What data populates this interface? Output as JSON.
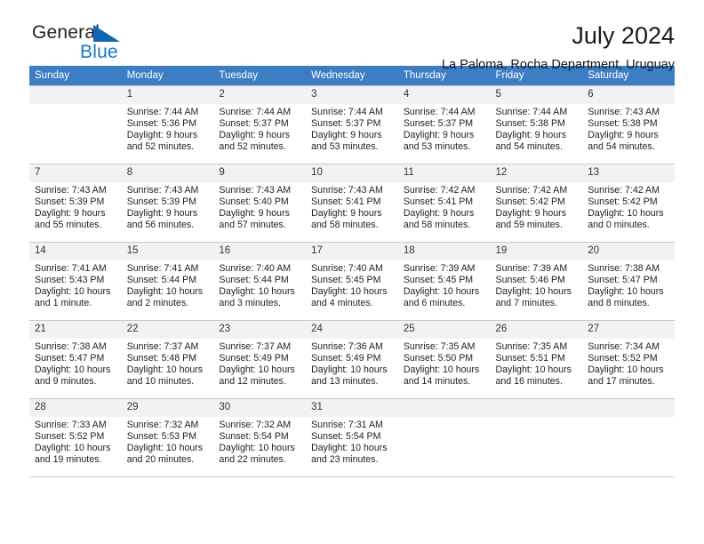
{
  "brand": {
    "name_part1": "General",
    "name_part2": "Blue",
    "triangle_color": "#1266b3",
    "blue_color": "#1878c8"
  },
  "header": {
    "title": "July 2024",
    "subtitle": "La Paloma, Rocha Department, Uruguay",
    "header_bg": "#3c7dc4",
    "header_text_color": "#ffffff"
  },
  "weekday_headers": [
    "Sunday",
    "Monday",
    "Tuesday",
    "Wednesday",
    "Thursday",
    "Friday",
    "Saturday"
  ],
  "weeks": [
    [
      {
        "day": "",
        "lines": []
      },
      {
        "day": "1",
        "lines": [
          "Sunrise: 7:44 AM",
          "Sunset: 5:36 PM",
          "Daylight: 9 hours",
          "and 52 minutes."
        ]
      },
      {
        "day": "2",
        "lines": [
          "Sunrise: 7:44 AM",
          "Sunset: 5:37 PM",
          "Daylight: 9 hours",
          "and 52 minutes."
        ]
      },
      {
        "day": "3",
        "lines": [
          "Sunrise: 7:44 AM",
          "Sunset: 5:37 PM",
          "Daylight: 9 hours",
          "and 53 minutes."
        ]
      },
      {
        "day": "4",
        "lines": [
          "Sunrise: 7:44 AM",
          "Sunset: 5:37 PM",
          "Daylight: 9 hours",
          "and 53 minutes."
        ]
      },
      {
        "day": "5",
        "lines": [
          "Sunrise: 7:44 AM",
          "Sunset: 5:38 PM",
          "Daylight: 9 hours",
          "and 54 minutes."
        ]
      },
      {
        "day": "6",
        "lines": [
          "Sunrise: 7:43 AM",
          "Sunset: 5:38 PM",
          "Daylight: 9 hours",
          "and 54 minutes."
        ]
      }
    ],
    [
      {
        "day": "7",
        "lines": [
          "Sunrise: 7:43 AM",
          "Sunset: 5:39 PM",
          "Daylight: 9 hours",
          "and 55 minutes."
        ]
      },
      {
        "day": "8",
        "lines": [
          "Sunrise: 7:43 AM",
          "Sunset: 5:39 PM",
          "Daylight: 9 hours",
          "and 56 minutes."
        ]
      },
      {
        "day": "9",
        "lines": [
          "Sunrise: 7:43 AM",
          "Sunset: 5:40 PM",
          "Daylight: 9 hours",
          "and 57 minutes."
        ]
      },
      {
        "day": "10",
        "lines": [
          "Sunrise: 7:43 AM",
          "Sunset: 5:41 PM",
          "Daylight: 9 hours",
          "and 58 minutes."
        ]
      },
      {
        "day": "11",
        "lines": [
          "Sunrise: 7:42 AM",
          "Sunset: 5:41 PM",
          "Daylight: 9 hours",
          "and 58 minutes."
        ]
      },
      {
        "day": "12",
        "lines": [
          "Sunrise: 7:42 AM",
          "Sunset: 5:42 PM",
          "Daylight: 9 hours",
          "and 59 minutes."
        ]
      },
      {
        "day": "13",
        "lines": [
          "Sunrise: 7:42 AM",
          "Sunset: 5:42 PM",
          "Daylight: 10 hours",
          "and 0 minutes."
        ]
      }
    ],
    [
      {
        "day": "14",
        "lines": [
          "Sunrise: 7:41 AM",
          "Sunset: 5:43 PM",
          "Daylight: 10 hours",
          "and 1 minute."
        ]
      },
      {
        "day": "15",
        "lines": [
          "Sunrise: 7:41 AM",
          "Sunset: 5:44 PM",
          "Daylight: 10 hours",
          "and 2 minutes."
        ]
      },
      {
        "day": "16",
        "lines": [
          "Sunrise: 7:40 AM",
          "Sunset: 5:44 PM",
          "Daylight: 10 hours",
          "and 3 minutes."
        ]
      },
      {
        "day": "17",
        "lines": [
          "Sunrise: 7:40 AM",
          "Sunset: 5:45 PM",
          "Daylight: 10 hours",
          "and 4 minutes."
        ]
      },
      {
        "day": "18",
        "lines": [
          "Sunrise: 7:39 AM",
          "Sunset: 5:45 PM",
          "Daylight: 10 hours",
          "and 6 minutes."
        ]
      },
      {
        "day": "19",
        "lines": [
          "Sunrise: 7:39 AM",
          "Sunset: 5:46 PM",
          "Daylight: 10 hours",
          "and 7 minutes."
        ]
      },
      {
        "day": "20",
        "lines": [
          "Sunrise: 7:38 AM",
          "Sunset: 5:47 PM",
          "Daylight: 10 hours",
          "and 8 minutes."
        ]
      }
    ],
    [
      {
        "day": "21",
        "lines": [
          "Sunrise: 7:38 AM",
          "Sunset: 5:47 PM",
          "Daylight: 10 hours",
          "and 9 minutes."
        ]
      },
      {
        "day": "22",
        "lines": [
          "Sunrise: 7:37 AM",
          "Sunset: 5:48 PM",
          "Daylight: 10 hours",
          "and 10 minutes."
        ]
      },
      {
        "day": "23",
        "lines": [
          "Sunrise: 7:37 AM",
          "Sunset: 5:49 PM",
          "Daylight: 10 hours",
          "and 12 minutes."
        ]
      },
      {
        "day": "24",
        "lines": [
          "Sunrise: 7:36 AM",
          "Sunset: 5:49 PM",
          "Daylight: 10 hours",
          "and 13 minutes."
        ]
      },
      {
        "day": "25",
        "lines": [
          "Sunrise: 7:35 AM",
          "Sunset: 5:50 PM",
          "Daylight: 10 hours",
          "and 14 minutes."
        ]
      },
      {
        "day": "26",
        "lines": [
          "Sunrise: 7:35 AM",
          "Sunset: 5:51 PM",
          "Daylight: 10 hours",
          "and 16 minutes."
        ]
      },
      {
        "day": "27",
        "lines": [
          "Sunrise: 7:34 AM",
          "Sunset: 5:52 PM",
          "Daylight: 10 hours",
          "and 17 minutes."
        ]
      }
    ],
    [
      {
        "day": "28",
        "lines": [
          "Sunrise: 7:33 AM",
          "Sunset: 5:52 PM",
          "Daylight: 10 hours",
          "and 19 minutes."
        ]
      },
      {
        "day": "29",
        "lines": [
          "Sunrise: 7:32 AM",
          "Sunset: 5:53 PM",
          "Daylight: 10 hours",
          "and 20 minutes."
        ]
      },
      {
        "day": "30",
        "lines": [
          "Sunrise: 7:32 AM",
          "Sunset: 5:54 PM",
          "Daylight: 10 hours",
          "and 22 minutes."
        ]
      },
      {
        "day": "31",
        "lines": [
          "Sunrise: 7:31 AM",
          "Sunset: 5:54 PM",
          "Daylight: 10 hours",
          "and 23 minutes."
        ]
      },
      {
        "day": "",
        "lines": []
      },
      {
        "day": "",
        "lines": []
      },
      {
        "day": "",
        "lines": []
      }
    ]
  ]
}
